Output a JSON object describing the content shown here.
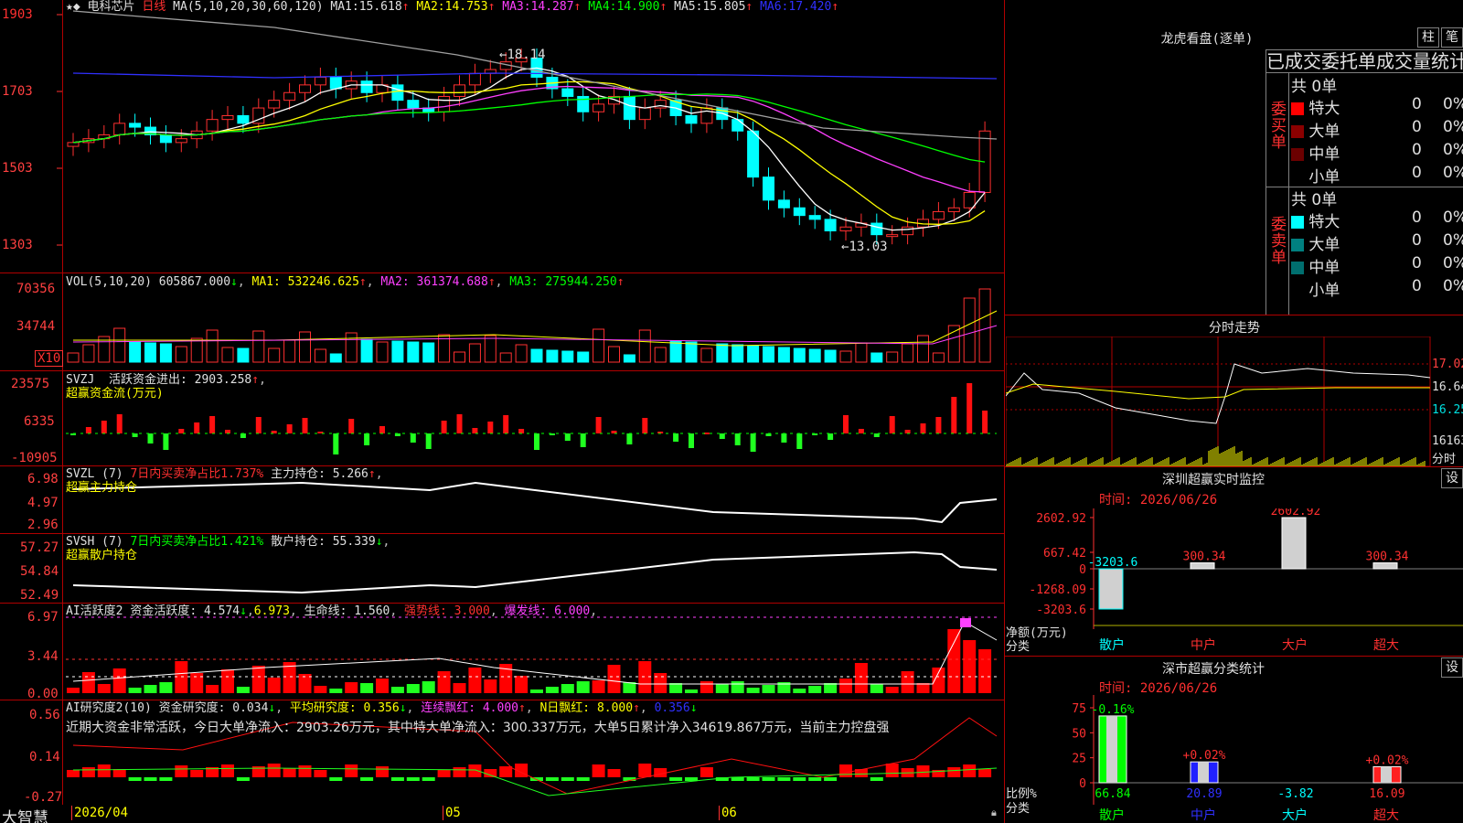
{
  "stock": {
    "name": "电科芯片",
    "period": "日线",
    "ma_param": "MA(5,10,20,30,60,120)",
    "ma": [
      {
        "k": "MA1:",
        "v": "15.618"
      },
      {
        "k": "MA2:",
        "v": "14.753"
      },
      {
        "k": "MA3:",
        "v": "14.287"
      },
      {
        "k": "MA4:",
        "v": "14.900"
      },
      {
        "k": "MA5:",
        "v": "15.805"
      },
      {
        "k": "MA6:",
        "v": "17.420"
      }
    ],
    "price_ticks": [
      "1903",
      "1703",
      "1503",
      "1303"
    ],
    "high_label": "18.14",
    "low_label": "13.03"
  },
  "vol": {
    "param": "VOL(5,10,20)",
    "value": "605867.000",
    "ma1": "MA1: 532246.625",
    "ma2": "MA2: 361374.688",
    "ma3": "MA3: 275944.250",
    "ticks": [
      "70356",
      "34744"
    ],
    "unit": "X10"
  },
  "svzj": {
    "name": "SVZJ",
    "text": "活跃资金进出: 2903.258",
    "sub": "超赢资金流(万元)",
    "ticks": [
      "23575",
      "6335",
      "-10905"
    ]
  },
  "svzl": {
    "name": "SVZL (7)",
    "pct": "7日内买卖净占比1.737%",
    "hold": "主力持仓: 5.266",
    "sub": "超赢主力持仓",
    "ticks": [
      "6.98",
      "4.97",
      "2.96"
    ]
  },
  "svsh": {
    "name": "SVSH (7)",
    "pct": "7日内买卖净占比1.421%",
    "hold": "散户持仓: 55.339",
    "sub": "超赢散户持仓",
    "ticks": [
      "57.27",
      "54.84",
      "52.49"
    ]
  },
  "ai1": {
    "name": "AI活跃度2",
    "a": "资金活跃度: 4.574",
    "b": "6.973",
    "c": "生命线: 1.560",
    "d": "强势线: 3.000",
    "e": "爆发线: 6.000",
    "ticks": [
      "6.97",
      "3.44",
      "0.00"
    ]
  },
  "ai2": {
    "name": "AI研究度2(10)",
    "a": "资金研究度: 0.034",
    "b": "平均研究度: 0.356",
    "c": "连续飘红: 4.000",
    "d": "N日飘红: 8.000",
    "e": "0.356",
    "text": "近期大资金非常活跃，今日大单净流入：2903.26万元，其中特大单净流入：300.337万元，大单5日累计净入34619.867万元，当前主力控盘强",
    "ticks": [
      "0.56",
      "0.14",
      "-0.27"
    ]
  },
  "dates": [
    "2026/04",
    "05",
    "06"
  ],
  "brand": "大智慧",
  "lhb": {
    "title": "龙虎看盘(逐单)",
    "btn1": "柱",
    "btn2": "笔",
    "header": "已成交委托单成交量统计",
    "buy": {
      "side": "委买单",
      "total": "共 0单",
      "rows": [
        {
          "name": "特大",
          "n": "0",
          "p": "0%",
          "color": "#ff0000"
        },
        {
          "name": "大单",
          "n": "0",
          "p": "0%",
          "color": "#8b0000"
        },
        {
          "name": "中单",
          "n": "0",
          "p": "0%",
          "color": "#6b0000"
        },
        {
          "name": "小单",
          "n": "0",
          "p": "0%",
          "color": "#000000"
        }
      ]
    },
    "sell": {
      "side": "委卖单",
      "total": "共 0单",
      "rows": [
        {
          "name": "特大",
          "n": "0",
          "p": "0%",
          "color": "#00ffff"
        },
        {
          "name": "大单",
          "n": "0",
          "p": "0%",
          "color": "#008080"
        },
        {
          "name": "中单",
          "n": "0",
          "p": "0%",
          "color": "#006f6f"
        },
        {
          "name": "小单",
          "n": "0",
          "p": "0%",
          "color": "#000000"
        }
      ]
    }
  },
  "fenshi": {
    "title": "分时走势",
    "ticks": [
      "17.02",
      "16.64",
      "16.25",
      "16163"
    ],
    "unit": "分时"
  },
  "monitor": {
    "title": "深圳超赢实时监控",
    "btn": "设",
    "date": "时间: 2026/06/26",
    "ticks": [
      "2602.92",
      "667.42",
      "0",
      "-1268.09",
      "-3203.6"
    ],
    "unit1": "净额(万元)",
    "unit2": "分类",
    "bars": [
      {
        "cat": "散户",
        "v": -3203.6,
        "label": "-3203.6"
      },
      {
        "cat": "中户",
        "v": 300.34,
        "label": "300.34"
      },
      {
        "cat": "大户",
        "v": 2602.92,
        "label": "2602.92"
      },
      {
        "cat": "超大",
        "v": 300.34,
        "label": "300.34"
      }
    ]
  },
  "classify": {
    "title": "深市超赢分类统计",
    "btn": "设",
    "date": "时间: 2026/06/26",
    "ticks": [
      "75",
      "50",
      "25",
      "0"
    ],
    "unit1": "比例%",
    "unit2": "分类",
    "bars": [
      {
        "cat": "散户",
        "v": 66.84,
        "top": "-0.16%",
        "bottom": "66.84"
      },
      {
        "cat": "中户",
        "v": 20.89,
        "top": "+0.02%",
        "bottom": "20.89"
      },
      {
        "cat": "大户",
        "v": -3.82,
        "top": "",
        "bottom": "-3.82"
      },
      {
        "cat": "超大",
        "v": 16.09,
        "top": "+0.02%",
        "bottom": "16.09"
      }
    ]
  }
}
